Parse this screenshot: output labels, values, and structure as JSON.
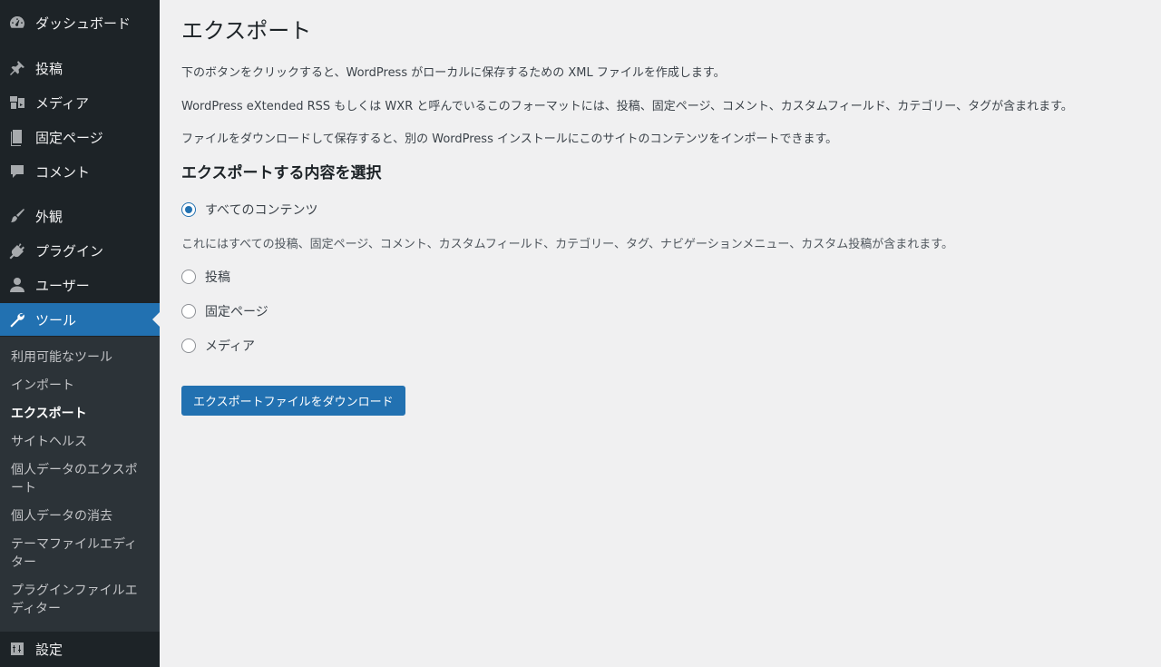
{
  "sidebar": {
    "items": [
      {
        "label": "ダッシュボード",
        "icon": "dashboard-icon"
      },
      {
        "label": "投稿",
        "icon": "pin-icon"
      },
      {
        "label": "メディア",
        "icon": "media-icon"
      },
      {
        "label": "固定ページ",
        "icon": "page-icon"
      },
      {
        "label": "コメント",
        "icon": "comment-icon"
      },
      {
        "label": "外観",
        "icon": "paintbrush-icon"
      },
      {
        "label": "プラグイン",
        "icon": "plugin-icon"
      },
      {
        "label": "ユーザー",
        "icon": "user-icon"
      },
      {
        "label": "ツール",
        "icon": "wrench-icon"
      },
      {
        "label": "設定",
        "icon": "settings-icon"
      }
    ],
    "submenu": [
      "利用可能なツール",
      "インポート",
      "エクスポート",
      "サイトヘルス",
      "個人データのエクスポート",
      "個人データの消去",
      "テーマファイルエディター",
      "プラグインファイルエディター"
    ]
  },
  "main": {
    "title": "エクスポート",
    "intro": [
      "下のボタンをクリックすると、WordPress がローカルに保存するための XML ファイルを作成します。",
      "WordPress eXtended RSS もしくは WXR と呼んでいるこのフォーマットには、投稿、固定ページ、コメント、カスタムフィールド、カテゴリー、タグが含まれます。",
      "ファイルをダウンロードして保存すると、別の WordPress インストールにこのサイトのコンテンツをインポートできます。"
    ],
    "section_title": "エクスポートする内容を選択",
    "options": [
      {
        "label": "すべてのコンテンツ",
        "checked": true
      },
      {
        "label": "投稿",
        "checked": false
      },
      {
        "label": "固定ページ",
        "checked": false
      },
      {
        "label": "メディア",
        "checked": false
      }
    ],
    "all_content_description": "これにはすべての投稿、固定ページ、コメント、カスタムフィールド、カテゴリー、タグ、ナビゲーションメニュー、カスタム投稿が含まれます。",
    "download_button": "エクスポートファイルをダウンロード"
  },
  "colors": {
    "sidebar_bg": "#1d2327",
    "submenu_bg": "#2c3338",
    "accent": "#2271b1",
    "page_bg": "#f0f0f1"
  }
}
